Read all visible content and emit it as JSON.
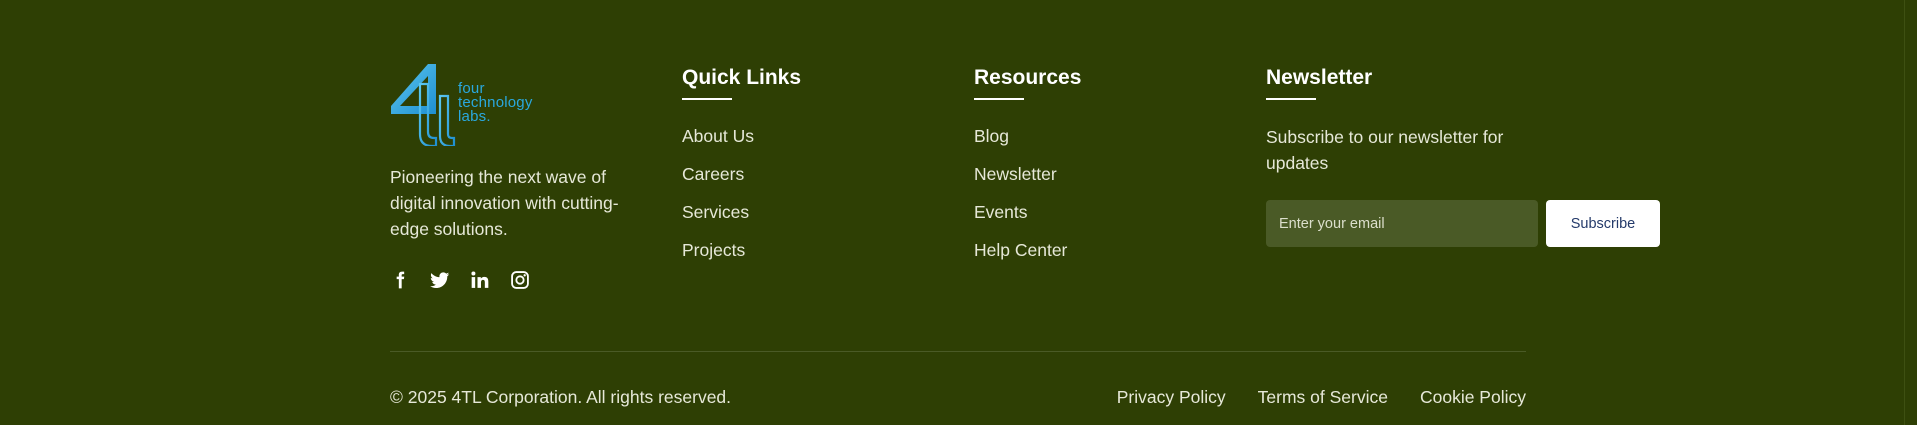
{
  "brand": {
    "logo_text": [
      "four",
      "technology",
      "labs."
    ],
    "logo_color": "#2aa8de",
    "tagline": "Pioneering the next wave of digital innovation with cutting-edge solutions.",
    "socials": [
      {
        "name": "facebook-icon"
      },
      {
        "name": "twitter-icon"
      },
      {
        "name": "linkedin-icon"
      },
      {
        "name": "instagram-icon"
      }
    ]
  },
  "quick_links": {
    "title": "Quick Links",
    "items": [
      "About Us",
      "Careers",
      "Services",
      "Projects"
    ]
  },
  "resources": {
    "title": "Resources",
    "items": [
      "Blog",
      "Newsletter",
      "Events",
      "Help Center"
    ]
  },
  "newsletter": {
    "title": "Newsletter",
    "description": "Subscribe to our newsletter for updates",
    "email_placeholder": "Enter your email",
    "email_value": "",
    "subscribe_label": "Subscribe"
  },
  "bottom": {
    "copyright": "© 2025 4TL Corporation. All rights reserved.",
    "legal_links": [
      "Privacy Policy",
      "Terms of Service",
      "Cookie Policy"
    ]
  },
  "colors": {
    "background": "#2e3f04",
    "input_background": "#4a5a26",
    "button_text": "#243a6a"
  }
}
